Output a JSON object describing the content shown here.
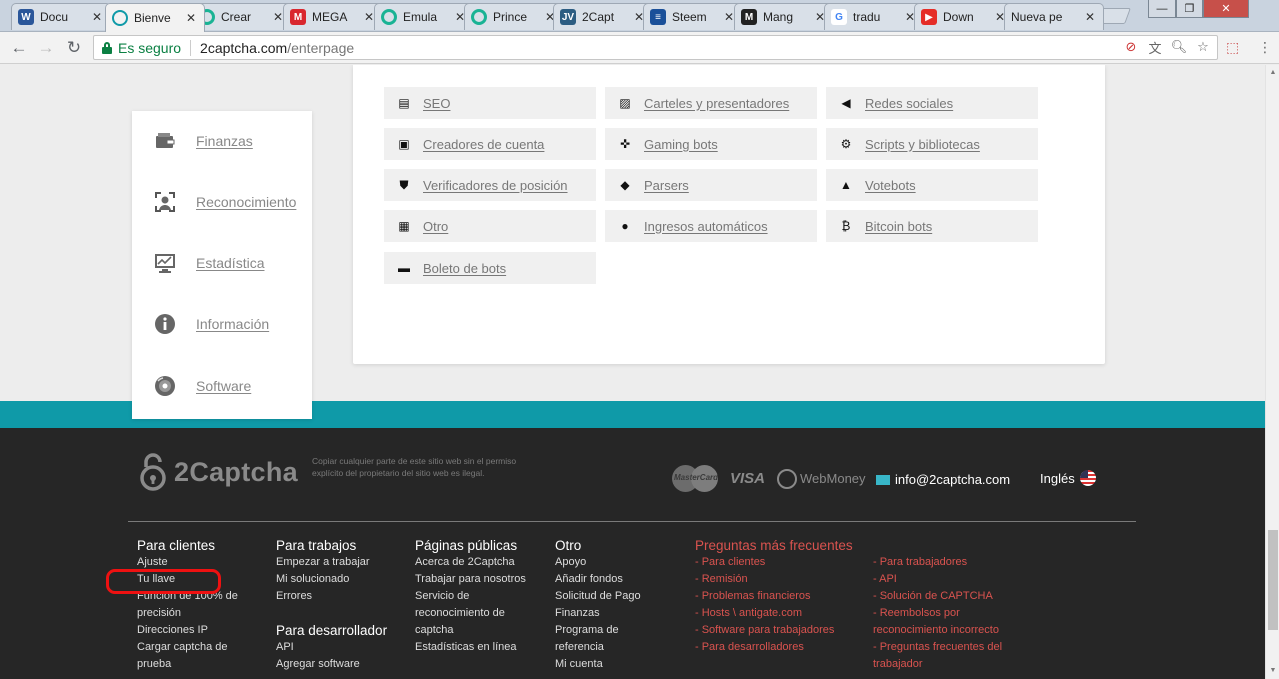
{
  "browser": {
    "tabs": [
      {
        "title": "Docu",
        "icon": "word-icon",
        "color": "#2b579a",
        "letter": "W"
      },
      {
        "title": "Bienve",
        "icon": "2captcha-icon",
        "color": "#ffffff",
        "letter": ""
      },
      {
        "title": "Crear",
        "icon": "circle-icon",
        "color": "#1ab394",
        "letter": ""
      },
      {
        "title": "MEGA",
        "icon": "mega-icon",
        "color": "#d9272e",
        "letter": "M"
      },
      {
        "title": "Emula",
        "icon": "circle-icon",
        "color": "#1ab394",
        "letter": ""
      },
      {
        "title": "Prince",
        "icon": "circle-icon",
        "color": "#1ab394",
        "letter": ""
      },
      {
        "title": "2Capt",
        "icon": "jv-icon",
        "color": "#2c5d82",
        "letter": "JV"
      },
      {
        "title": "Steem",
        "icon": "steem-icon",
        "color": "#1a5099",
        "letter": "≡"
      },
      {
        "title": "Mang",
        "icon": "manga-icon",
        "color": "#222222",
        "letter": "M"
      },
      {
        "title": "tradu",
        "icon": "google-icon",
        "color": "#ffffff",
        "letter": "G"
      },
      {
        "title": "Down",
        "icon": "youtube-icon",
        "color": "#e52d27",
        "letter": "▶"
      },
      {
        "title": "Nueva pe",
        "icon": "",
        "color": "",
        "letter": ""
      }
    ],
    "tab_close": "✕",
    "secure_label": "Es seguro",
    "url_domain": "2captcha.com",
    "url_path": "/enterpage"
  },
  "sidebar": {
    "items": [
      {
        "label": "Finanzas",
        "icon": "wallet-icon"
      },
      {
        "label": "Reconocimiento",
        "icon": "face-scan-icon"
      },
      {
        "label": "Estadística",
        "icon": "monitor-chart-icon"
      },
      {
        "label": "Información",
        "icon": "info-icon"
      },
      {
        "label": "Software",
        "icon": "disc-icon"
      }
    ]
  },
  "categories": {
    "items": [
      {
        "label": "SEO",
        "icon": "seo-icon",
        "glyph": "▤"
      },
      {
        "label": "Carteles y presentadores",
        "icon": "image-icon",
        "glyph": "▨"
      },
      {
        "label": "Redes sociales",
        "icon": "megaphone-icon",
        "glyph": "◀"
      },
      {
        "label": "Creadores de cuenta",
        "icon": "contact-card-icon",
        "glyph": "▣"
      },
      {
        "label": "Gaming bots",
        "icon": "gamepad-icon",
        "glyph": "✜"
      },
      {
        "label": "Scripts y bibliotecas",
        "icon": "gear-icon",
        "glyph": "⚙"
      },
      {
        "label": "Verificadores de posición",
        "icon": "shield-icon",
        "glyph": "⛊"
      },
      {
        "label": "Parsers",
        "icon": "diamond-icon",
        "glyph": "◆"
      },
      {
        "label": "Votebots",
        "icon": "vote-icon",
        "glyph": "▲"
      },
      {
        "label": "Otro",
        "icon": "grid-icon",
        "glyph": "▦"
      },
      {
        "label": "Ingresos automáticos",
        "icon": "coin-icon",
        "glyph": "●"
      },
      {
        "label": "Bitcoin bots",
        "icon": "bitcoin-icon",
        "glyph": "₿"
      },
      {
        "label": "Boleto de bots",
        "icon": "ticket-icon",
        "glyph": "▬"
      }
    ]
  },
  "footer": {
    "logo_text": "2Captcha",
    "copyright": "Copiar cualquier parte de este sitio web sin el permiso explícito del propietario del sitio web es ilegal.",
    "payments": {
      "mastercard": "MasterCard",
      "visa": "VISA",
      "webmoney": "WebMoney"
    },
    "email": "info@2captcha.com",
    "language": "Inglés",
    "col1": {
      "title": "Para clientes",
      "links": [
        "Ajuste",
        "Tu llave",
        "Función de 100% de precisión",
        "Direcciones IP",
        "Cargar captcha de prueba"
      ]
    },
    "col2": {
      "title": "Para trabajos",
      "links": [
        "Empezar a trabajar",
        "Mi solucionado",
        "Errores"
      ],
      "title2": "Para desarrollador",
      "links2": [
        "API",
        "Agregar software"
      ]
    },
    "col3": {
      "title": "Páginas públicas",
      "links": [
        "Acerca de 2Captcha",
        "Trabajar para nosotros",
        "Servicio de reconocimiento de captcha",
        "Estadísticas en línea"
      ]
    },
    "col4": {
      "title": "Otro",
      "links": [
        "Apoyo",
        "Añadir fondos",
        "Solicitud de Pago",
        "Finanzas",
        "Programa de referencia",
        "Mi cuenta"
      ]
    },
    "faq": {
      "title": "Preguntas más frecuentes",
      "left": [
        "- Para clientes",
        "- Remisión",
        "- Problemas financieros",
        "- Hosts \\ antigate.com",
        "- Software para trabajadores",
        "- Para desarrolladores"
      ],
      "right": [
        "- Para trabajadores",
        "- API",
        "- Solución de CAPTCHA",
        "- Reembolsos por reconocimiento incorrecto",
        "- Preguntas frecuentes del trabajador"
      ]
    }
  }
}
